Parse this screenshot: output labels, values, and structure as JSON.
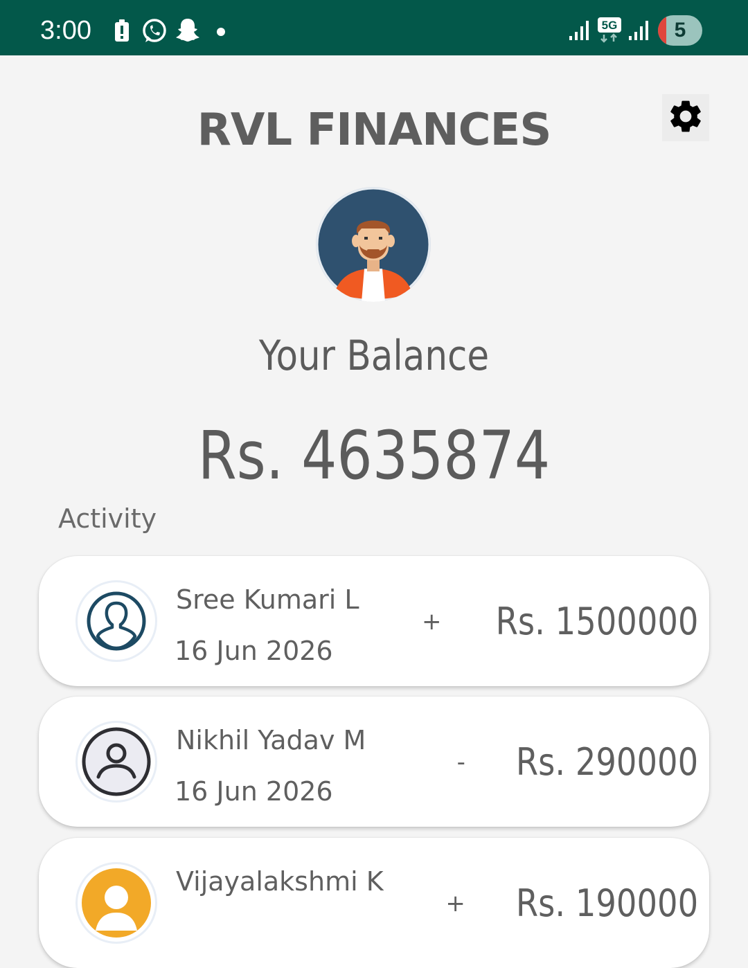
{
  "status_bar": {
    "time": "3:00",
    "network": "5G",
    "battery": "5"
  },
  "header": {
    "title": "RVL FINANCES",
    "settings_icon": "gear-icon"
  },
  "balance": {
    "label": "Your Balance",
    "amount": "Rs. 4635874"
  },
  "activity": {
    "label": "Activity",
    "items": [
      {
        "name": "Sree Kumari L",
        "date": "16 Jun 2026",
        "sign": "+",
        "amount": "Rs. 1500000",
        "icon": "person-outline-icon"
      },
      {
        "name": "Nikhil Yadav M",
        "date": "16 Jun 2026",
        "sign": "-",
        "amount": "Rs. 290000",
        "icon": "person-circle-icon"
      },
      {
        "name": "Vijayalakshmi K",
        "date": "",
        "sign": "+",
        "amount": "Rs. 190000",
        "icon": "person-avatar-orange-icon"
      }
    ]
  },
  "colors": {
    "status_bar": "#03584a",
    "background": "#f4f4f4",
    "text": "#5f5f5f"
  }
}
